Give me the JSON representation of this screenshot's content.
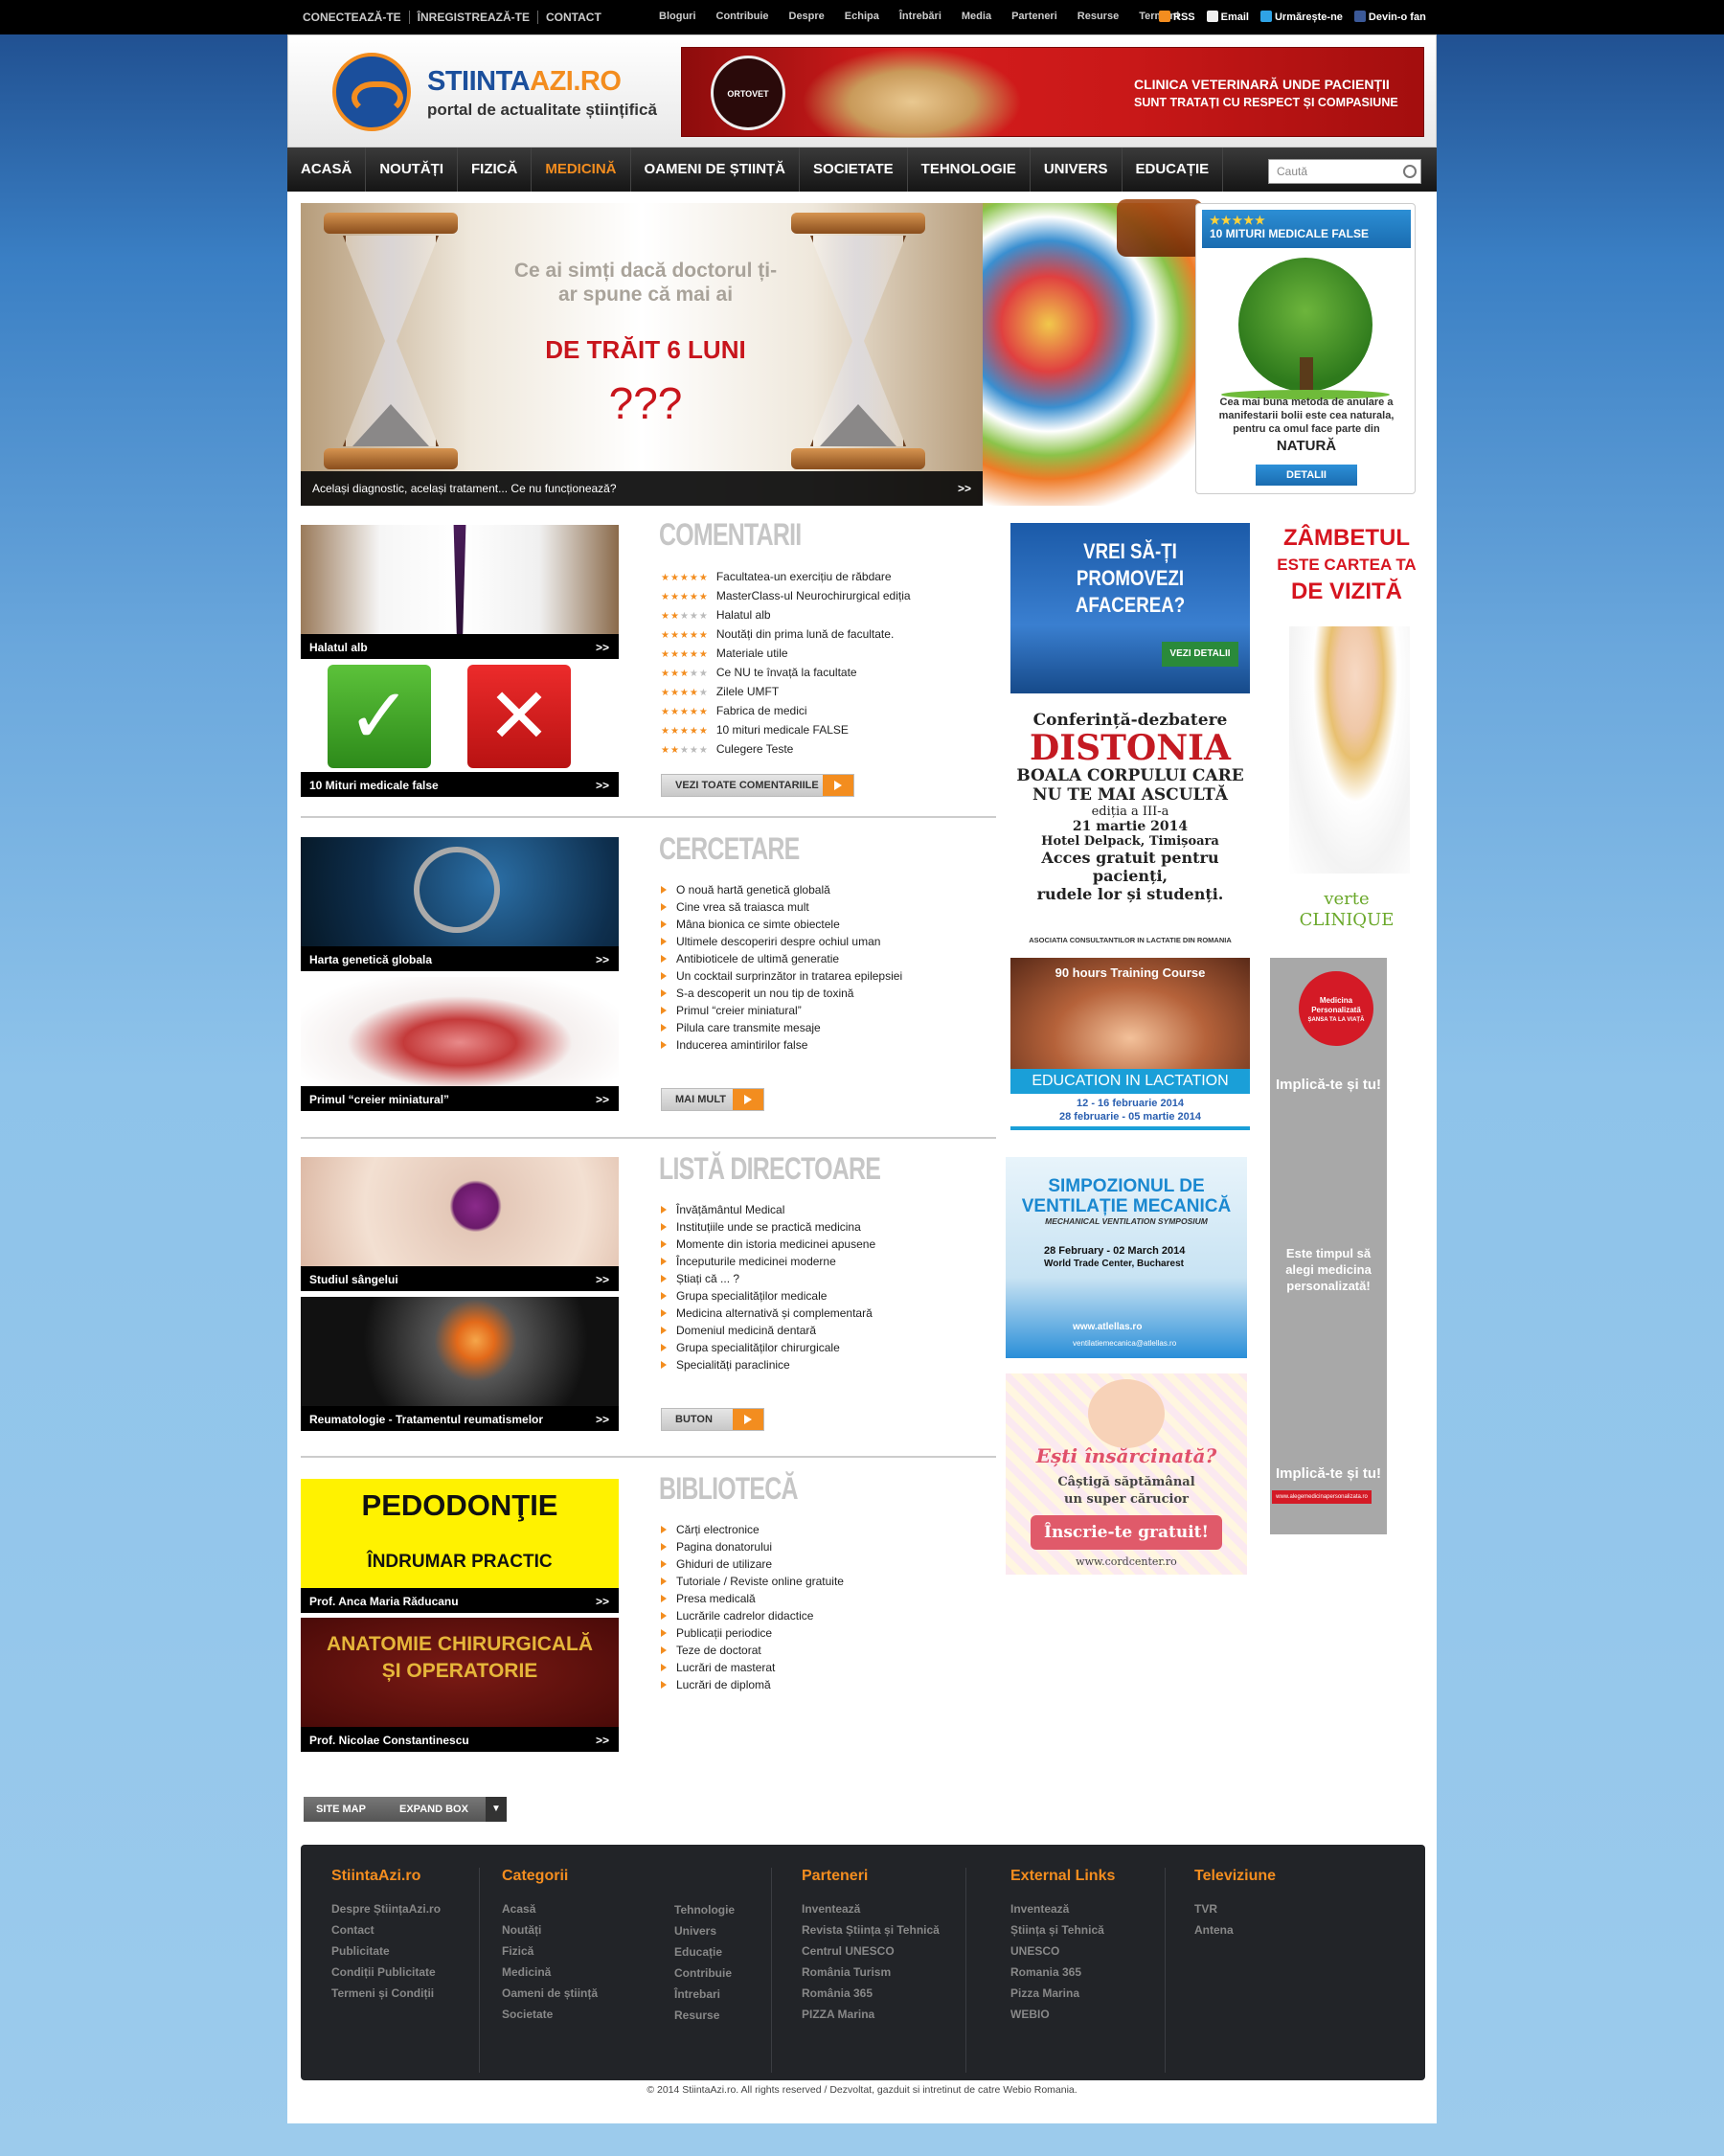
{
  "topbar": {
    "left": [
      "CONECTEAZĂ-TE",
      "ÎNREGISTREAZĂ-TE",
      "CONTACT"
    ],
    "links": [
      "Bloguri",
      "Contribuie",
      "Despre",
      "Echipa",
      "Întrebări",
      "Media",
      "Parteneri",
      "Resurse",
      "Termeni"
    ],
    "social": {
      "rss": "RSS",
      "email": "Email",
      "follow": "Urmărește-ne",
      "fan": "Devin-o fan"
    }
  },
  "header": {
    "logo_main": "STIINTA",
    "logo_accent": "AZI.RO",
    "subtitle": "portal de actualitate științifică",
    "banner": {
      "seal": "ORTOVET",
      "line1": "CLINICA VETERINARĂ UNDE PACIENȚII",
      "line2": "SUNT TRATAȚI CU RESPECT ȘI COMPASIUNE"
    }
  },
  "nav": {
    "items": [
      "ACASĂ",
      "NOUTĂȚI",
      "FIZICĂ",
      "MEDICINĂ",
      "OAMENI DE ȘTIINȚĂ",
      "SOCIETATE",
      "TEHNOLOGIE",
      "UNIVERS",
      "EDUCAȚIE"
    ],
    "active": "MEDICINĂ",
    "search_placeholder": "Caută"
  },
  "hero": {
    "q1": "Ce ai simți dacă doctorul ți-ar spune că mai ai",
    "q2": "DE TRĂIT 6 LUNI",
    "q3": "???",
    "caption": "Același diagnostic, același tratament... Ce nu funcționează?",
    "arrow": ">>"
  },
  "myth": {
    "stars": "★★★★★",
    "title": "10 MITURI MEDICALE FALSE",
    "text": "Cea mai buna metoda de anulare a manifestarii bolii este cea naturala, pentru ca omul face parte din",
    "nature": "NATURĂ",
    "button": "DETALII"
  },
  "comentarii": {
    "title": "COMENTARII",
    "items": [
      {
        "text": "Facultatea-un exercițiu de răbdare",
        "rating": 5
      },
      {
        "text": "MasterClass-ul Neurochirurgical ediția",
        "rating": 5
      },
      {
        "text": "Halatul alb",
        "rating": 2
      },
      {
        "text": "Noutăți din prima lună de facultate.",
        "rating": 5
      },
      {
        "text": "Materiale utile",
        "rating": 5
      },
      {
        "text": "Ce NU te învață la facultate",
        "rating": 3
      },
      {
        "text": "Zilele UMFT",
        "rating": 4
      },
      {
        "text": "Fabrica de medici",
        "rating": 5
      },
      {
        "text": "10 mituri medicale FALSE",
        "rating": 5
      },
      {
        "text": "Culegere Teste",
        "rating": 2
      }
    ],
    "button": "VEZI TOATE COMENTARIILE"
  },
  "cercetare": {
    "title": "CERCETARE",
    "items": [
      "O nouă hartă genetică globală",
      "Cine vrea să traiasca mult",
      "Mâna bionica ce simte obiectele",
      "Ultimele descoperiri despre ochiul uman",
      "Antibioticele de ultimă generatie",
      "Un cocktail surprinzător in tratarea epilepsiei",
      "S-a descoperit un nou tip de toxină",
      "Primul “creier miniatural”",
      "Pilula care transmite mesaje",
      "Inducerea amintirilor false"
    ],
    "button": "MAI MULT"
  },
  "directoare": {
    "title": "LISTĂ DIRECTOARE",
    "items": [
      "Învățământul Medical",
      "Instituțiile unde se practică medicina",
      "Momente din istoria medicinei apusene",
      "Începuturile medicinei moderne",
      "Știați că ... ?",
      "Grupa specialităților medicale",
      "Medicina alternativă și complementară",
      "Domeniul medicină dentară",
      "Grupa specialităților chirurgicale",
      "Specialități paraclinice"
    ],
    "button": "BUTON"
  },
  "biblioteca": {
    "title": "BIBLIOTECĂ",
    "items": [
      "Cărți electronice",
      "Pagina donatorului",
      "Ghiduri de utilizare",
      "Tutoriale / Reviste online gratuite",
      "Presa medicală",
      "Lucrările cadrelor didactice",
      "Publicații periodice",
      "Teze de doctorat",
      "Lucrări de masterat",
      "Lucrări de diplomă"
    ]
  },
  "cards": {
    "halatul": "Halatul alb",
    "mituri": "10 Mituri medicale false",
    "harta": "Harta genetică globala",
    "creier": "Primul “creier miniatural”",
    "sange": "Studiul sângelui",
    "reumatologie": "Reumatologie - Tratamentul reumatismelor",
    "pedo_title": "PEDODONŢIE",
    "pedo_sub": "ÎNDRUMAR PRACTIC",
    "pedo_author": "Prof. Anca Maria Răducanu",
    "anat_title": "ANATOMIE CHIRURGICALĂ ȘI OPERATORIE",
    "anat_author": "Prof. Nicolae Constantinescu",
    "arrow": ">>"
  },
  "ads": {
    "promo": "VREI SĂ-ȚI PROMOVEZI AFACEREA?",
    "promo_btn": "VEZI DETALII",
    "distonia": {
      "l1": "Conferință-dezbatere",
      "l2": "DISTONIA",
      "l3": "BOALA CORPULUI CARE",
      "l4": "NU TE MAI ASCULTĂ",
      "l5": "ediția a III-a",
      "l6": "21 martie 2014",
      "l7": "Hotel Delpack, Timișoara",
      "l8": "Acces gratuit pentru pacienți,",
      "l9": "rudele lor și studenți."
    },
    "lact": {
      "org": "ASOCIATIA CONSULTANTILOR IN LACTATIE DIN ROMANIA",
      "course": "90 hours Training Course",
      "title": "EDUCATION IN LACTATION",
      "d1": "12 - 16 februarie 2014",
      "d2": "28 februarie - 05 martie 2014"
    },
    "vent": {
      "t1": "SIMPOZIONUL DE",
      "t2": "VENTILAȚIE MECANICĂ",
      "sub": "MECHANICAL VENTILATION SYMPOSIUM",
      "date": "28 February - 02 March 2014",
      "place": "World Trade Center, Bucharest",
      "url": "www.atlellas.ro",
      "mail": "ventilatiemecanica@atlellas.ro"
    },
    "cord": {
      "q": "Ești însărcinată?",
      "l1": "Câștigă săptămânal",
      "l2": "un super cărucior",
      "btn": "Înscrie-te gratuit!",
      "url": "www.cordcenter.ro"
    },
    "smile": {
      "l1": "ZÂMBETUL",
      "l2": "ESTE CARTEA TA",
      "l3": "DE VIZITĂ",
      "brand": "verte",
      "brand2": "CLINIQUE"
    },
    "pers": {
      "badge1": "Medicina",
      "badge2": "Personalizată",
      "badge3": "ȘANSA TA LA VIAȚĂ",
      "top": "Implică-te și tu!",
      "mid": "Este timpul să alegi medicina personalizată!",
      "bottom": "Implică-te și tu!",
      "url": "www.alegemedicinapersonalizata.ro"
    }
  },
  "footer": {
    "sitemap": "SITE MAP",
    "expand": "EXPAND BOX",
    "expand_arrow": "▼",
    "col1": {
      "title": "StiintaAzi.ro",
      "items": [
        "Despre ȘtiințaAzi.ro",
        "Contact",
        "Publicitate",
        "Condiții Publicitate",
        "Termeni și Condiții"
      ]
    },
    "col2": {
      "title": "Categorii",
      "a": [
        "Acasă",
        "Noutăți",
        "Fizică",
        "Medicină",
        "Oameni de știință",
        "Societate"
      ],
      "b": [
        "Tehnologie",
        "Univers",
        "Educație",
        "Contribuie",
        "Întrebari",
        "Resurse"
      ]
    },
    "col3": {
      "title": "Parteneri",
      "items": [
        "Inventează",
        "Revista Știința și Tehnică",
        "Centrul UNESCO",
        "România Turism",
        "România 365",
        "PIZZA Marina"
      ]
    },
    "col4": {
      "title": "External Links",
      "items": [
        "Inventează",
        "Știința și Tehnică",
        "UNESCO",
        "Romania 365",
        "Pizza Marina",
        "WEBIO"
      ]
    },
    "col5": {
      "title": "Televiziune",
      "items": [
        "TVR",
        "Antena"
      ]
    },
    "copyright": "© 2014 StiintaAzi.ro. All rights reserved / Dezvoltat, gazduit si intretinut de catre Webio Romania."
  },
  "colors": {
    "accent": "#f38d1f",
    "brand": "#1b4f9c"
  }
}
